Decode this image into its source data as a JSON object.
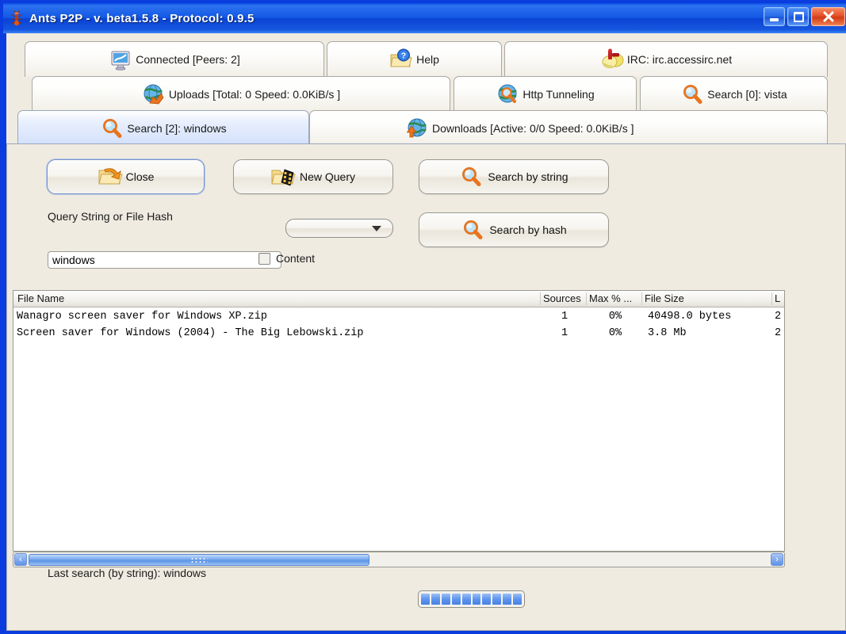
{
  "window": {
    "title": "Ants P2P - v. beta1.5.8 - Protocol: 0.9.5",
    "icon": "ant-icon",
    "controls": {
      "minimize": "minimize-button",
      "maximize": "maximize-button",
      "close": "close-button"
    },
    "colors": {
      "titlebar_blue": "#1358E4",
      "panel_beige": "#EFEBE0",
      "active_tab_blue": "#D2E0FB",
      "scroll_blue": "#7FAFF0",
      "close_red": "#E4512A"
    }
  },
  "tabs": [
    {
      "label": "Connected [Peers: 2]",
      "icon": "monitor-icon",
      "active": false
    },
    {
      "label": "Help",
      "icon": "help-folder-icon",
      "active": false
    },
    {
      "label": "IRC: irc.accessirc.net",
      "icon": "irc-chat-icon",
      "active": false
    },
    {
      "label": "Uploads [Total: 0 Speed: 0.0KiB/s ]",
      "icon": "globe-upload-icon",
      "active": false
    },
    {
      "label": "Http Tunneling",
      "icon": "globe-search-icon",
      "active": false
    },
    {
      "label": "Search [0]: vista",
      "icon": "magnifier-icon",
      "active": false
    },
    {
      "label": "Search [2]: windows",
      "icon": "magnifier-icon",
      "active": true
    },
    {
      "label": "Downloads [Active: 0/0 Speed: 0.0KiB/s ]",
      "icon": "globe-download-icon",
      "active": false
    }
  ],
  "toolbar": {
    "close_label": "Close",
    "close_icon": "folder-back-arrow-icon",
    "new_query_label": "New Query",
    "new_query_icon": "folder-film-icon",
    "search_by_string_label": "Search by string",
    "search_by_string_icon": "magnifier-icon",
    "search_by_hash_label": "Search by hash",
    "search_by_hash_icon": "magnifier-icon"
  },
  "query": {
    "field_label": "Query String or File Hash",
    "value": "windows",
    "placeholder": "",
    "combo_value": "",
    "content_checkbox_label": "Content",
    "content_checked": false
  },
  "results_table": {
    "columns": [
      "File Name",
      "Sources",
      "Max % ...",
      "File Size",
      "L"
    ],
    "rows": [
      {
        "file_name": "Wanagro screen saver for Windows XP.zip",
        "sources": "1",
        "max_pct": "0%",
        "file_size": "40498.0 bytes",
        "last": "2"
      },
      {
        "file_name": "Screen saver for Windows (2004) - The Big Lebowski.zip",
        "sources": "1",
        "max_pct": "0%",
        "file_size": "3.8 Mb",
        "last": "2"
      }
    ]
  },
  "scrollbar": {
    "left_arrow": "‹",
    "right_arrow": "›",
    "thumb_position_pct": 0,
    "thumb_width_pct": 46
  },
  "status": {
    "last_search": "Last search (by string): windows",
    "progress_blocks": 10
  }
}
